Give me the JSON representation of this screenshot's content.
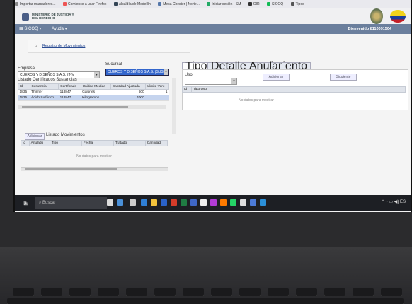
{
  "bookmarks": [
    "Importar marcadores...",
    "Comience a usar Firefox",
    "Alcaldía de Medellín",
    "Mesa Chester | Norte...",
    "Iniciar sesión · SM",
    "OIR",
    "SICOQ",
    "Tipos"
  ],
  "header": {
    "org_line1": "MINISTERIO DE JUSTICIA Y",
    "org_line2": "DEL DERECHO"
  },
  "menubar": {
    "menu1": "SICOQ",
    "menu2": "Ayuda",
    "welcome": "Bienvenido 8110091504"
  },
  "breadcrumb": {
    "home": "⌂",
    "label": "Registro de Movimientos"
  },
  "form": {
    "empresa_label": "Empresa",
    "empresa_value": "CUEROS Y DISEÑOS S.A.S. (INV",
    "sucursal_label": "Sucursal",
    "sucursal_value": "CUEROS Y DISEÑOS S.A.S. (SUS",
    "list_title": "Listado Certificados Sustancias"
  },
  "certificados": {
    "columns": [
      "Id",
      "Sustancia",
      "Certificado",
      "Unidad Medida",
      "Cantidad Ajustada",
      "Límite Vent"
    ],
    "rows": [
      [
        "1835",
        "Thinner",
        "118847",
        "Galones",
        "600",
        "1"
      ],
      [
        "1835",
        "Ácido Sulfúrico",
        "118847",
        "Kilogramos",
        "4000",
        ""
      ]
    ]
  },
  "movimientos": {
    "adicionar": "Adicionar",
    "title": "Listado Movimientos",
    "columns": [
      "Id",
      "Anulado",
      "Tipo",
      "Fecha",
      "Tratado",
      "Cantidad"
    ],
    "empty": "No datos para mostrar"
  },
  "tabs": [
    "Tipos Mov",
    "Detalle Movimiento",
    "Anular"
  ],
  "right": {
    "uso_label": "Uso",
    "adicionar": "Adicionar",
    "siguiente": "Siguiente",
    "columns": [
      "Id",
      "Tipo Uso"
    ],
    "empty": "No datos para mostrar"
  },
  "taskbar": {
    "search_placeholder": "Buscar",
    "tray": "^ ◔ ▭ ◀) ES"
  },
  "colors": {
    "menubar": "#6b7f9d",
    "accent": "#3366cc",
    "link": "#2b4c93"
  }
}
